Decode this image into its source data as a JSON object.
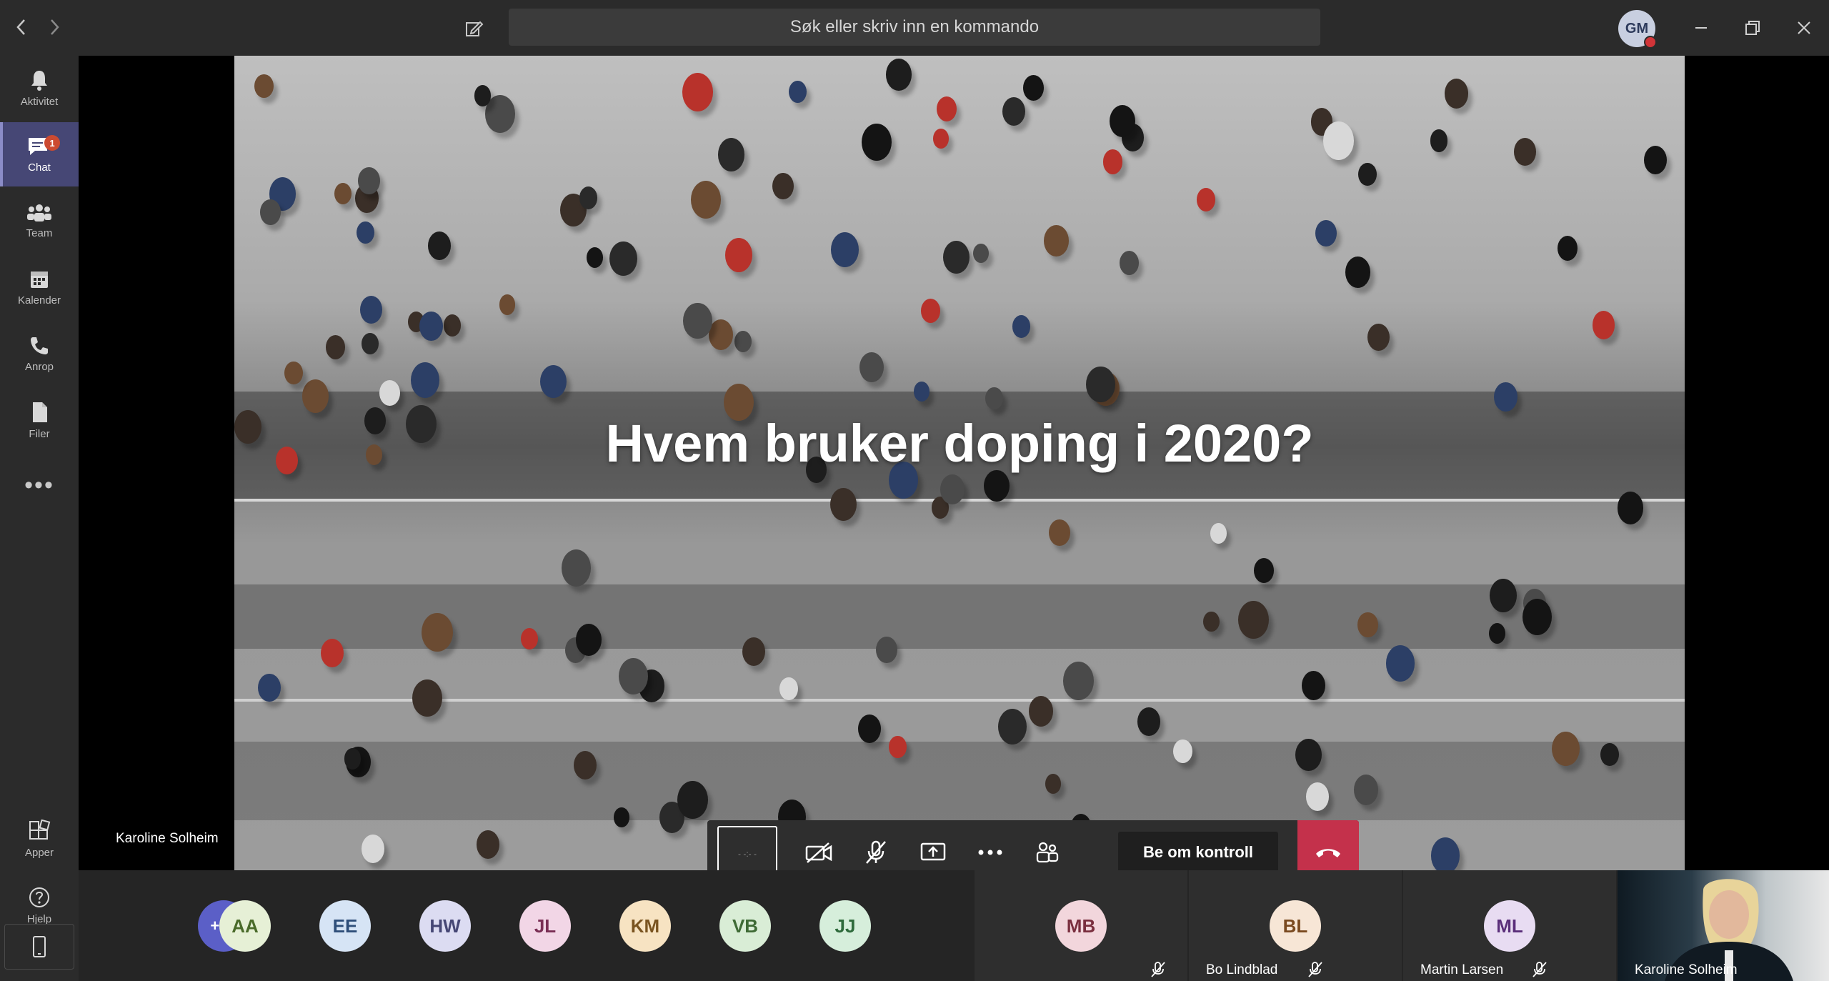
{
  "titlebar": {
    "search_placeholder": "Søk eller skriv inn en kommando",
    "user_initials": "GM"
  },
  "rail": {
    "items": [
      {
        "label": "Aktivitet",
        "icon": "bell-icon"
      },
      {
        "label": "Chat",
        "icon": "chat-icon",
        "badge": "1"
      },
      {
        "label": "Team",
        "icon": "team-icon"
      },
      {
        "label": "Kalender",
        "icon": "calendar-icon"
      },
      {
        "label": "Anrop",
        "icon": "phone-icon"
      },
      {
        "label": "Filer",
        "icon": "files-icon"
      }
    ],
    "more": "•••",
    "bottom_items": [
      {
        "label": "Apper",
        "icon": "apps-icon"
      },
      {
        "label": "Hjelp",
        "icon": "help-icon"
      }
    ]
  },
  "stage": {
    "slide_title": "Hvem bruker doping i 2020?",
    "presenter_name": "Karoline Solheim"
  },
  "controls": {
    "request_control_label": "Be om kontroll",
    "timer_text": "- -:- -"
  },
  "participants": {
    "overflow": "+16",
    "avatars": [
      {
        "initials": "AA",
        "bg": "#e6f0d6",
        "fg": "#4a6b2a"
      },
      {
        "initials": "EE",
        "bg": "#d6e4f5",
        "fg": "#2f4f7a"
      },
      {
        "initials": "HW",
        "bg": "#dcdcf2",
        "fg": "#464775"
      },
      {
        "initials": "JL",
        "bg": "#f2d6e6",
        "fg": "#7a2f55"
      },
      {
        "initials": "KM",
        "bg": "#f7e3c2",
        "fg": "#7a5420"
      },
      {
        "initials": "VB",
        "bg": "#d9edd6",
        "fg": "#3f6b36"
      },
      {
        "initials": "JJ",
        "bg": "#d6eedb",
        "fg": "#2f6b3c"
      }
    ],
    "tiles": [
      {
        "initials": "MB",
        "name": "",
        "bg": "#f2d6dc",
        "fg": "#7a2f3f"
      },
      {
        "initials": "BL",
        "name": "Bo Lindblad",
        "bg": "#f7e6d6",
        "fg": "#7a4a20"
      },
      {
        "initials": "ML",
        "name": "Martin Larsen",
        "bg": "#e8dcf2",
        "fg": "#5b2f7a"
      }
    ],
    "self_name": "Karoline Solheim"
  },
  "colors": {
    "rail_active": "#464775",
    "hangup": "#c4314b",
    "badge": "#cc4a31"
  }
}
